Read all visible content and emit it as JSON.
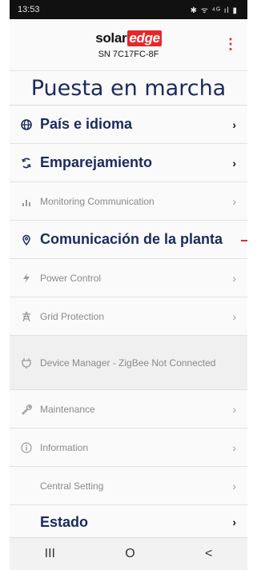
{
  "status": {
    "time": "13:53",
    "icons": "✱ ᯤ ⁴ᴳ ıl ▮"
  },
  "header": {
    "logo_solar": "solar",
    "logo_edge": "edge",
    "serial": "SN 7C17FC-8F",
    "menu_icon": "kebab-icon"
  },
  "page": {
    "title": "Puesta en marcha"
  },
  "menu": [
    {
      "label": "País e idioma",
      "icon": "globe-icon",
      "enabled": true
    },
    {
      "label": "Emparejamiento",
      "icon": "sync-icon",
      "enabled": true
    },
    {
      "label": "Monitoring Communication",
      "icon": "signal-bars-icon",
      "enabled": false
    },
    {
      "label": "Comunicación de la planta",
      "icon": "location-pin-icon",
      "enabled": true
    },
    {
      "label": "Power Control",
      "icon": "lightning-icon",
      "enabled": false
    },
    {
      "label": "Grid Protection",
      "icon": "power-tower-icon",
      "enabled": false
    },
    {
      "label": "Device Manager - ZigBee Not Connected",
      "icon": "plug-icon",
      "enabled": false
    },
    {
      "label": "Maintenance",
      "icon": "wrench-icon",
      "enabled": false
    },
    {
      "label": "Information",
      "icon": "info-icon",
      "enabled": false
    },
    {
      "label": "Central Setting",
      "icon": "",
      "enabled": false
    },
    {
      "label": "Estado",
      "icon": "",
      "enabled": true
    }
  ],
  "chevron": "›",
  "navbar": {
    "recents": "III",
    "home": "O",
    "back": "<"
  },
  "colors": {
    "brand_red": "#e4282c",
    "navy": "#1c2a5c"
  }
}
